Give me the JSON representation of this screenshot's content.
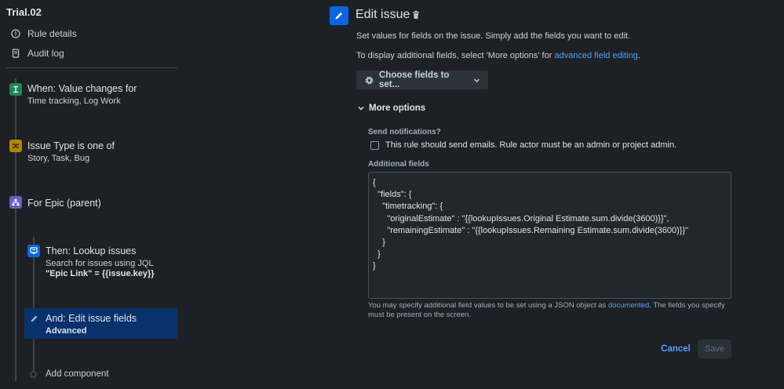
{
  "sidebar": {
    "rule_name": "Trial.02",
    "links": [
      {
        "label": "Rule details",
        "icon": "info-icon"
      },
      {
        "label": "Audit log",
        "icon": "document-icon"
      }
    ],
    "steps": [
      {
        "title": "When: Value changes for",
        "sub": "Time tracking, Log Work",
        "icon": "trigger-icon",
        "color": "#1f845a"
      },
      {
        "title": "Issue Type is one of",
        "sub": "Story, Task, Bug",
        "icon": "shuffle-icon",
        "color": "#b38600"
      },
      {
        "title": "For Epic (parent)",
        "icon": "hierarchy-icon",
        "color": "#6e5dc6"
      },
      {
        "title": "Then: Lookup issues",
        "sub": "Search for issues using JQL",
        "sub2": "\"Epic Link\" = {{issue.key}}",
        "icon": "lookup-icon",
        "color": "#0c66e4"
      },
      {
        "title": "And: Edit issue fields",
        "sub2": "Advanced",
        "icon": "pencil-icon",
        "color": "#0c66e4"
      }
    ],
    "add_component": "Add component"
  },
  "main": {
    "title": "Edit issue",
    "description": "Set values for fields on the issue. Simply add the fields you want to edit.",
    "display_prefix": "To display additional fields, select 'More options' for ",
    "display_link": "advanced field editing",
    "display_suffix": ".",
    "choose_fields": "Choose fields to set...",
    "more_options": "More options",
    "send_notifications_label": "Send notifications?",
    "send_emails_text": "This rule should send emails. Rule actor must be an admin or project admin.",
    "send_emails_checked": false,
    "additional_fields_label": "Additional fields",
    "additional_fields_value": "{\n  \"fields\": {\n    \"timetracking\": {\n      \"originalEstimate\" : \"{{lookupIssues.Original Estimate.sum.divide(3600)}}\",\n      \"remainingEstimate\" : \"{{lookupIssues.Remaining Estimate.sum.divide(3600)}}\"\n    }\n  }\n}",
    "help_prefix": "You may specify additional field values to be set using a JSON object as ",
    "help_link": "documented",
    "help_suffix": ". The fields you specify must be present on the screen.",
    "cancel": "Cancel",
    "save": "Save"
  },
  "colors": {
    "background": "#1d2125",
    "accent": "#0c66e4",
    "link": "#579dff",
    "selected": "#09326c"
  }
}
